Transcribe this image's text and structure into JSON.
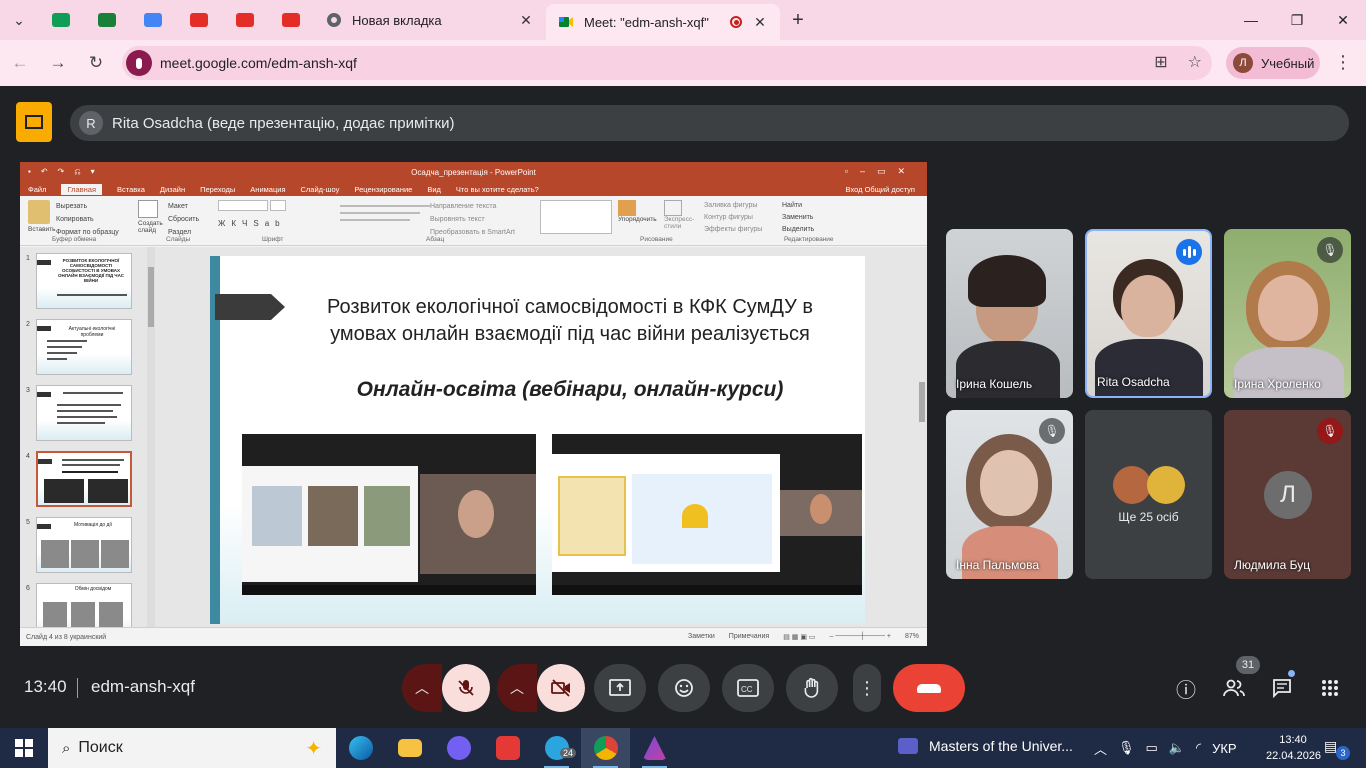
{
  "browser": {
    "tabs": [
      {
        "title": "Новая вкладка",
        "active": false
      },
      {
        "title": "Meet: \"edm-ansh-xqf\"",
        "active": true
      }
    ],
    "new_tab_glyph": "+",
    "url": "meet.google.com/edm-ansh-xqf",
    "profile_initial": "Л",
    "profile_name": "Учебный"
  },
  "meet": {
    "presenter_initial": "R",
    "presenter_text": "Rita Osadcha (веде презентацію, додає примітки)",
    "time": "13:40",
    "meeting_code": "edm-ansh-xqf",
    "participant_count": "31",
    "participants": [
      {
        "name": "Ірина Кошель",
        "muted": false,
        "speaking": false
      },
      {
        "name": "Rita Osadcha",
        "muted": false,
        "speaking": true
      },
      {
        "name": "Ірина Хроленко",
        "muted": true,
        "speaking": false
      },
      {
        "name": "Інна Пальмова",
        "muted": true,
        "speaking": false
      },
      {
        "name": "Ще 25 осіб",
        "muted": false,
        "speaking": false
      },
      {
        "name": "Людмила Буц",
        "muted": true,
        "speaking": false,
        "initial": "Л"
      }
    ],
    "colors": {
      "end_call": "#ea4335",
      "presenter_warning": "#f9ab00",
      "speaking": "#1a73e8"
    }
  },
  "powerpoint": {
    "window_title": "Осадча_презентація - PowerPoint",
    "menu": [
      "Файл",
      "Главная",
      "Вставка",
      "Дизайн",
      "Переходы",
      "Анимация",
      "Слайд-шоу",
      "Рецензирование",
      "Вид",
      "Что вы хотите сделать?"
    ],
    "menu_right": "Вход   Общий доступ",
    "ribbon_groups": [
      "Буфер обмена",
      "Слайды",
      "Шрифт",
      "Абзац",
      "Рисование",
      "Редактирование"
    ],
    "clipboard_items": [
      "Вставить",
      "Вырезать",
      "Копировать",
      "Формат по образцу"
    ],
    "slides_items": [
      "Создать слайд",
      "Макет",
      "Сбросить",
      "Раздел"
    ],
    "drawing_items": [
      "Упорядочить",
      "Экспресс-стили",
      "Заливка фигуры",
      "Контур фигуры",
      "Эффекты фигуры"
    ],
    "editing_items": [
      "Найти",
      "Заменить",
      "Выделить"
    ],
    "paragraph_items": [
      "Направление текста",
      "Выровнять текст",
      "Преобразовать в SmartArt"
    ],
    "thumbnails": [
      "1",
      "2",
      "3",
      "4",
      "5",
      "6"
    ],
    "thumb_titles": [
      "РОЗВИТОК ЕКОЛОГІЧНОЇ САМОСВІДОМОСТІ ОСОБИСТОСТІ В УМОВАХ ОНЛАЙН ВЗАЄМОДІЇ ПІД ЧАС ВІЙНИ",
      "Актуальні екологічні проблеми",
      "",
      "",
      "Мотивація до дії",
      "Обмін досвідом"
    ],
    "slide_title": "Розвиток екологічної самосвідомості в КФК СумДУ в умовах онлайн взаємодії під час війни реалізується",
    "slide_subtitle": "Онлайн-освіта (вебінари, онлайн-курси)",
    "status_left": "Слайд 4 из 8   украинский",
    "status_right": [
      "Заметки",
      "Примечания",
      "87%"
    ]
  },
  "taskbar": {
    "search_placeholder": "Поиск",
    "media_title": "Masters of the Univer...",
    "lang": "УКР",
    "clock_time": "13:40",
    "clock_date": "22.04.2026",
    "notification_count": "3",
    "telegram_badge": "24"
  }
}
